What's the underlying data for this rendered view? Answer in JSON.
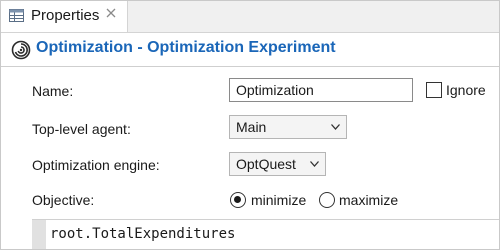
{
  "tab": {
    "label": "Properties",
    "icon": "properties-table-icon",
    "close_icon": "close-icon"
  },
  "header": {
    "icon": "optimization-experiment-icon",
    "title": "Optimization - Optimization Experiment",
    "title_color": "#1a66b8"
  },
  "form": {
    "name": {
      "label": "Name:",
      "value": "Optimization",
      "ignore_label": "Ignore",
      "ignore_checked": false
    },
    "top_level_agent": {
      "label": "Top-level agent:",
      "selected": "Main"
    },
    "engine": {
      "label": "Optimization engine:",
      "selected": "OptQuest"
    },
    "objective": {
      "label": "Objective:",
      "options": [
        "minimize",
        "maximize"
      ],
      "selected": "minimize",
      "expression": "root.TotalExpenditures"
    }
  }
}
